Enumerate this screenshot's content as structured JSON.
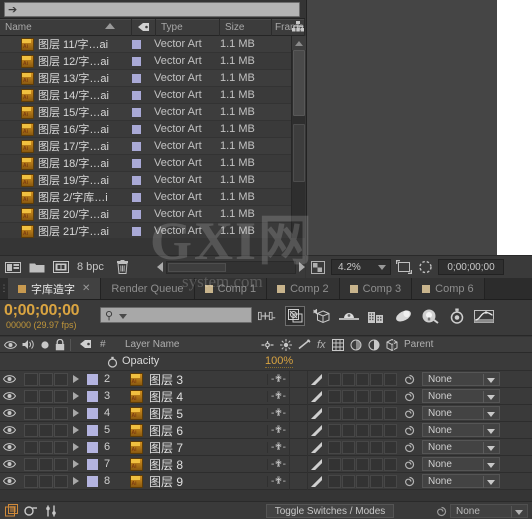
{
  "top_search": {
    "placeholder": ""
  },
  "project": {
    "columns": [
      "Name",
      "Type",
      "Size",
      "Frame"
    ],
    "files": [
      {
        "name": "图层 11/字…ai",
        "type": "Vector Art",
        "size": "1.1 MB"
      },
      {
        "name": "图层 12/字…ai",
        "type": "Vector Art",
        "size": "1.1 MB"
      },
      {
        "name": "图层 13/字…ai",
        "type": "Vector Art",
        "size": "1.1 MB"
      },
      {
        "name": "图层 14/字…ai",
        "type": "Vector Art",
        "size": "1.1 MB"
      },
      {
        "name": "图层 15/字…ai",
        "type": "Vector Art",
        "size": "1.1 MB"
      },
      {
        "name": "图层 16/字…ai",
        "type": "Vector Art",
        "size": "1.1 MB"
      },
      {
        "name": "图层 17/字…ai",
        "type": "Vector Art",
        "size": "1.1 MB"
      },
      {
        "name": "图层 18/字…ai",
        "type": "Vector Art",
        "size": "1.1 MB"
      },
      {
        "name": "图层 19/字…ai",
        "type": "Vector Art",
        "size": "1.1 MB"
      },
      {
        "name": "图层 2/字库…i",
        "type": "Vector Art",
        "size": "1.1 MB"
      },
      {
        "name": "图层 20/字…ai",
        "type": "Vector Art",
        "size": "1.1 MB"
      },
      {
        "name": "图层 21/字…ai",
        "type": "Vector Art",
        "size": "1.1 MB"
      }
    ],
    "footer": {
      "bit_depth": "8 bpc"
    }
  },
  "viewer_bar": {
    "zoom": "4.2%",
    "timecode": "0;00;00;00"
  },
  "tabs": [
    {
      "label": "字库造字",
      "active": true,
      "closable": true
    },
    {
      "label": "Render Queue",
      "active": false,
      "closable": false
    },
    {
      "label": "Comp 1",
      "active": false,
      "closable": false
    },
    {
      "label": "Comp 2",
      "active": false,
      "closable": false
    },
    {
      "label": "Comp 3",
      "active": false,
      "closable": false
    },
    {
      "label": "Comp 6",
      "active": false,
      "closable": false
    }
  ],
  "timeline": {
    "timecode": "0;00;00;00",
    "frames_fps": "00000 (29.97 fps)",
    "search_placeholder": ""
  },
  "layer_columns": {
    "number": "#",
    "layer_name": "Layer Name",
    "parent": "Parent"
  },
  "opacity": {
    "label": "Opacity",
    "value": "100%"
  },
  "layers": [
    {
      "num": "2",
      "name": "图层 3",
      "parent": "None"
    },
    {
      "num": "3",
      "name": "图层 4",
      "parent": "None"
    },
    {
      "num": "4",
      "name": "图层 5",
      "parent": "None"
    },
    {
      "num": "5",
      "name": "图层 6",
      "parent": "None"
    },
    {
      "num": "6",
      "name": "图层 7",
      "parent": "None"
    },
    {
      "num": "7",
      "name": "图层 8",
      "parent": "None"
    },
    {
      "num": "8",
      "name": "图层 9",
      "parent": "None"
    }
  ],
  "bottom": {
    "toggle_label": "Toggle Switches / Modes",
    "parent_value": "None"
  },
  "watermark": {
    "line1": "GXI网",
    "line2": "system.com"
  },
  "colors": {
    "accent": "#d9a441",
    "layer_swatch": "#b4b4e0",
    "tab_dot": "#c89a50"
  }
}
